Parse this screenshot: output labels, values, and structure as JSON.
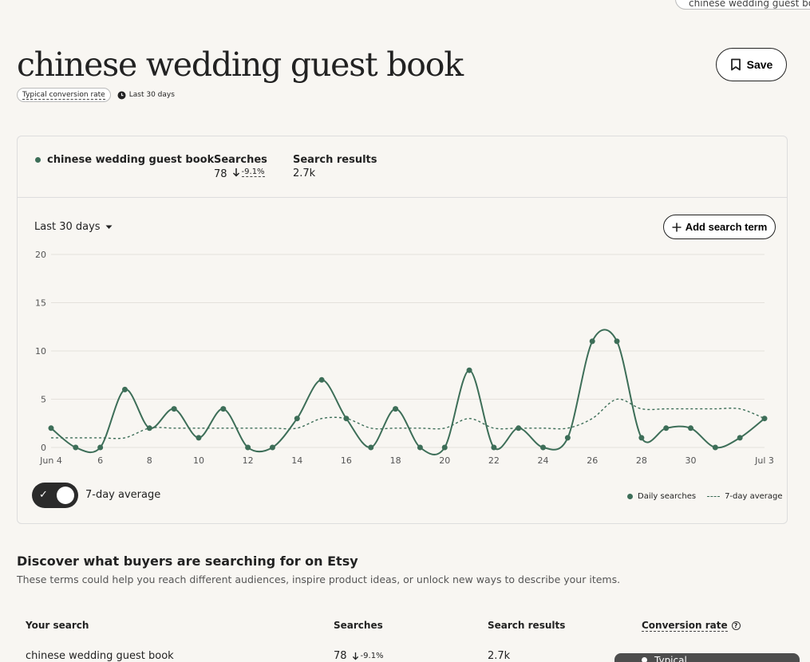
{
  "top_pill": {
    "label": "chinese wedding guest book"
  },
  "header": {
    "title": "chinese wedding guest book",
    "save_label": "Save",
    "tag_conversion": "Typical conversion rate",
    "tag_range": "Last 30 days"
  },
  "summary": {
    "term": "chinese wedding guest book",
    "searches_label": "Searches",
    "searches_value": "78",
    "searches_delta": "-9.1%",
    "results_label": "Search results",
    "results_value": "2.7k"
  },
  "controls": {
    "range_label": "Last 30 days",
    "add_label": "Add search term",
    "toggle_label": "7-day average",
    "toggle_on": true
  },
  "legend": {
    "daily": "Daily searches",
    "avg": "7-day average"
  },
  "colors": {
    "series": "#3d6e58",
    "accent": "#222222"
  },
  "chart_data": {
    "type": "line",
    "x": [
      "Jun 4",
      "Jun 5",
      "Jun 6",
      "Jun 7",
      "Jun 8",
      "Jun 9",
      "Jun 10",
      "Jun 11",
      "Jun 12",
      "Jun 13",
      "Jun 14",
      "Jun 15",
      "Jun 16",
      "Jun 17",
      "Jun 18",
      "Jun 19",
      "Jun 20",
      "Jun 21",
      "Jun 22",
      "Jun 23",
      "Jun 24",
      "Jun 25",
      "Jun 26",
      "Jun 27",
      "Jun 28",
      "Jun 29",
      "Jun 30",
      "Jul 1",
      "Jul 2",
      "Jul 3"
    ],
    "x_ticks": [
      "Jun 4",
      "6",
      "8",
      "10",
      "12",
      "14",
      "16",
      "18",
      "20",
      "22",
      "24",
      "26",
      "28",
      "30",
      "Jul 3"
    ],
    "x_tick_index": [
      0,
      2,
      4,
      6,
      8,
      10,
      12,
      14,
      16,
      18,
      20,
      22,
      24,
      26,
      29
    ],
    "y_ticks": [
      "0",
      "5",
      "10",
      "15",
      "20"
    ],
    "ylim": [
      0,
      20
    ],
    "grid": true,
    "legend_position": "bottom-right",
    "series": [
      {
        "name": "Daily searches",
        "style": "solid-with-markers",
        "values": [
          2,
          0,
          0,
          6,
          2,
          4,
          1,
          4,
          0,
          0,
          3,
          7,
          3,
          0,
          4,
          0,
          0,
          8,
          0,
          2,
          0,
          1,
          11,
          11,
          1,
          2,
          2,
          0,
          1,
          3
        ]
      },
      {
        "name": "7-day average",
        "style": "dashed",
        "values": [
          1,
          1,
          1,
          1,
          2,
          2,
          2,
          2,
          2,
          2,
          2,
          3,
          3,
          2,
          2,
          2,
          2,
          3,
          2,
          2,
          2,
          2,
          3,
          5,
          4,
          4,
          4,
          4,
          4,
          3
        ]
      }
    ]
  },
  "discover": {
    "title": "Discover what buyers are searching for on Etsy",
    "subtitle": "These terms could help you reach different audiences, inspire product ideas, or unlock new ways to describe your items."
  },
  "table": {
    "headers": {
      "search": "Your search",
      "searches": "Searches",
      "results": "Search results",
      "conversion": "Conversion rate"
    },
    "row": {
      "search": "chinese wedding guest book",
      "searches": "78",
      "delta": "-9.1%",
      "results": "2.7k",
      "conversion": "Typical"
    }
  }
}
